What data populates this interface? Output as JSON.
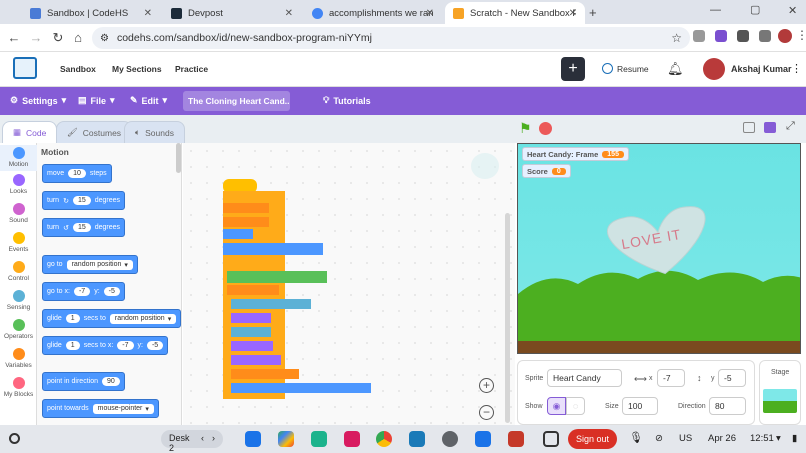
{
  "browser": {
    "tabs": [
      {
        "title": "Sandbox | CodeHS",
        "color": "#4a7bd6"
      },
      {
        "title": "Devpost",
        "color": "#1c2b3a"
      },
      {
        "title": "accomplishments we ran into",
        "color": "#4285f4"
      },
      {
        "title": "Scratch - New Sandbox Program",
        "color": "#f7a325"
      }
    ],
    "url": "codehs.com/sandbox/id/new-sandbox-program-niYYmj"
  },
  "codehs": {
    "nav": [
      "Sandbox",
      "My Sections",
      "Practice"
    ],
    "resume": "Resume",
    "user": "Akshaj Kumar",
    "plus": "+"
  },
  "scratch": {
    "menu": {
      "settings": "Settings",
      "file": "File",
      "edit": "Edit",
      "project_title": "The Cloning Heart Cand...",
      "tutorials": "Tutorials"
    },
    "tabs": {
      "code": "Code",
      "costumes": "Costumes",
      "sounds": "Sounds"
    },
    "categories": [
      {
        "label": "Motion",
        "color": "#4c97ff"
      },
      {
        "label": "Looks",
        "color": "#9966ff"
      },
      {
        "label": "Sound",
        "color": "#cf63cf"
      },
      {
        "label": "Events",
        "color": "#ffbf00"
      },
      {
        "label": "Control",
        "color": "#ffab19"
      },
      {
        "label": "Sensing",
        "color": "#5cb1d6"
      },
      {
        "label": "Operators",
        "color": "#59c059"
      },
      {
        "label": "Variables",
        "color": "#ff8c1a"
      },
      {
        "label": "My Blocks",
        "color": "#ff6680"
      }
    ],
    "palette": {
      "heading": "Motion",
      "move": {
        "a": "move",
        "v": "10",
        "b": "steps"
      },
      "turn_right": {
        "a": "turn",
        "v": "15",
        "b": "degrees"
      },
      "turn_left": {
        "a": "turn",
        "v": "15",
        "b": "degrees"
      },
      "goto": {
        "a": "go to",
        "dd": "random position"
      },
      "goto_xy": {
        "a": "go to x:",
        "x": "-7",
        "b": "y:",
        "y": "-5"
      },
      "glide": {
        "a": "glide",
        "v": "1",
        "b": "secs to",
        "dd": "random position"
      },
      "glide_xy": {
        "a": "glide",
        "v": "1",
        "b": "secs to x:",
        "x": "-7",
        "c": "y:",
        "y": "-5"
      },
      "point_dir": {
        "a": "point in direction",
        "v": "90"
      },
      "point_towards": {
        "a": "point towards",
        "dd": "mouse-pointer"
      }
    },
    "monitors": [
      {
        "label": "Heart Candy: Frame",
        "value": "155"
      },
      {
        "label": "Score",
        "value": "0"
      }
    ],
    "heart_text": "LOVE IT",
    "sprite": {
      "sprite_label": "Sprite",
      "name": "Heart Candy",
      "x_label": "x",
      "x": "-7",
      "y_label": "y",
      "y": "-5",
      "show_label": "Show",
      "size_label": "Size",
      "size": "100",
      "dir_label": "Direction",
      "direction": "80"
    },
    "stage_label": "Stage",
    "colors": {
      "purple": "#855cd6",
      "motion": "#4c97ff",
      "control": "#ffab19",
      "ground": "#4caf20"
    }
  },
  "shelf": {
    "desk": "Desk 2",
    "signout": "Sign out",
    "lang": "US",
    "date": "Apr 26",
    "time": "12:51"
  }
}
